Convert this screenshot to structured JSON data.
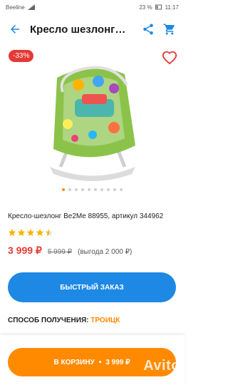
{
  "status": {
    "carrier": "Beeline",
    "battery": "23 %",
    "time": "11:17"
  },
  "header": {
    "title": "Кресло шезлонг…",
    "back_icon": "arrow-left-icon",
    "share_icon": "share-icon",
    "cart_icon": "cart-icon"
  },
  "gallery": {
    "discount": "-33%",
    "dots_total": 10,
    "dots_active": 0
  },
  "product": {
    "name": "Кресло-шезлонг Be2Me 88955, артикул 344962",
    "rating": 4.5,
    "price_now": "3 999 ₽",
    "price_old": "5 999 ₽",
    "savings": "(выгода 2 000 ₽)"
  },
  "actions": {
    "quick_order": "БЫСТРЫЙ ЗАКАЗ",
    "delivery_label": "СПОСОБ ПОЛУЧЕНИЯ:",
    "delivery_city": "ТРОИЦК",
    "cart_label": "В КОРЗИНУ",
    "cart_dot": "•",
    "cart_price": "3 999 ₽"
  },
  "watermark": "Avito",
  "colors": {
    "accent_blue": "#1e88e5",
    "accent_orange": "#ff8a00",
    "price_red": "#e53935"
  }
}
